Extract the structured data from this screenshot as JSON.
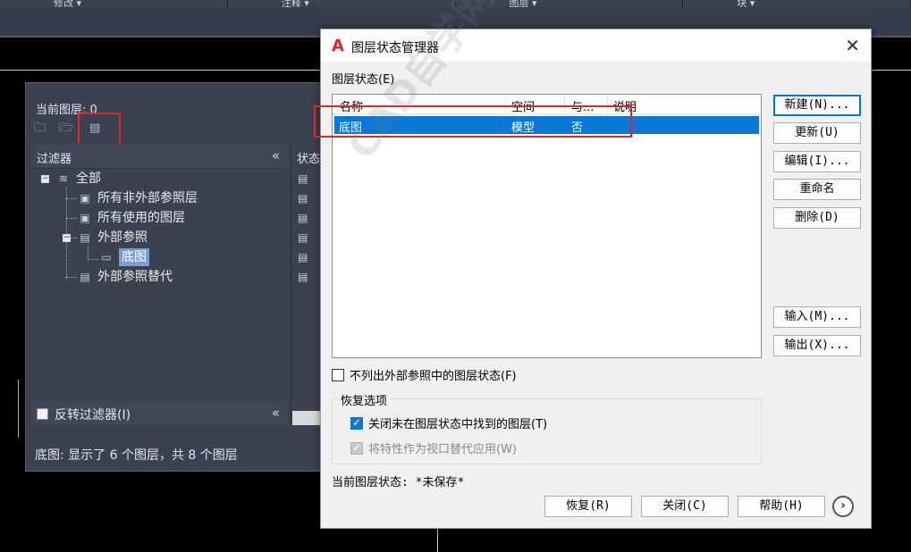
{
  "ribbon": {
    "panels": [
      "修改 ▾",
      "注释 ▾",
      "图层 ▾",
      "块 ▾"
    ]
  },
  "palette": {
    "current_layer": "当前图层: 0",
    "filter_header": "过滤器",
    "status_header": "状态",
    "tree": {
      "all": "全部",
      "non_xref": "所有非外部参照层",
      "used": "所有使用的图层",
      "xref": "外部参照",
      "xref_child": "底图",
      "xref_override": "外部参照替代"
    },
    "invert_filter": "反转过滤器(I)",
    "footer": "底图: 显示了 6 个图层，共 8 个图层"
  },
  "dialog": {
    "title": "图层状态管理器",
    "layer_states_label": "图层状态(E)",
    "columns": [
      "名称",
      "空间",
      "与...",
      "说明"
    ],
    "rows": [
      {
        "name": "底图",
        "space": "模型",
        "same": "否",
        "desc": ""
      }
    ],
    "buttons": {
      "new": "新建(N)...",
      "update": "更新(U)",
      "edit": "编辑(I)...",
      "rename": "重命名",
      "delete": "删除(D)",
      "import": "输入(M)...",
      "export": "输出(X)..."
    },
    "dont_list_xref": "不列出外部参照中的图层状态(F)",
    "restore_options": "恢复选项",
    "turn_off_not_found": "关闭未在图层状态中找到的图层(T)",
    "apply_as_viewport_override": "将特性作为视口替代应用(W)",
    "current_state": "当前图层状态: *未保存*",
    "bottom": {
      "restore": "恢复(R)",
      "close": "关闭(C)",
      "help": "帮助(H)"
    }
  },
  "watermark": "CAD自学网 www.cadzxw.com",
  "colors": {
    "selection": "#0a78d7",
    "highlight_box": "#e0262b",
    "palette_bg": "#3b4150"
  }
}
